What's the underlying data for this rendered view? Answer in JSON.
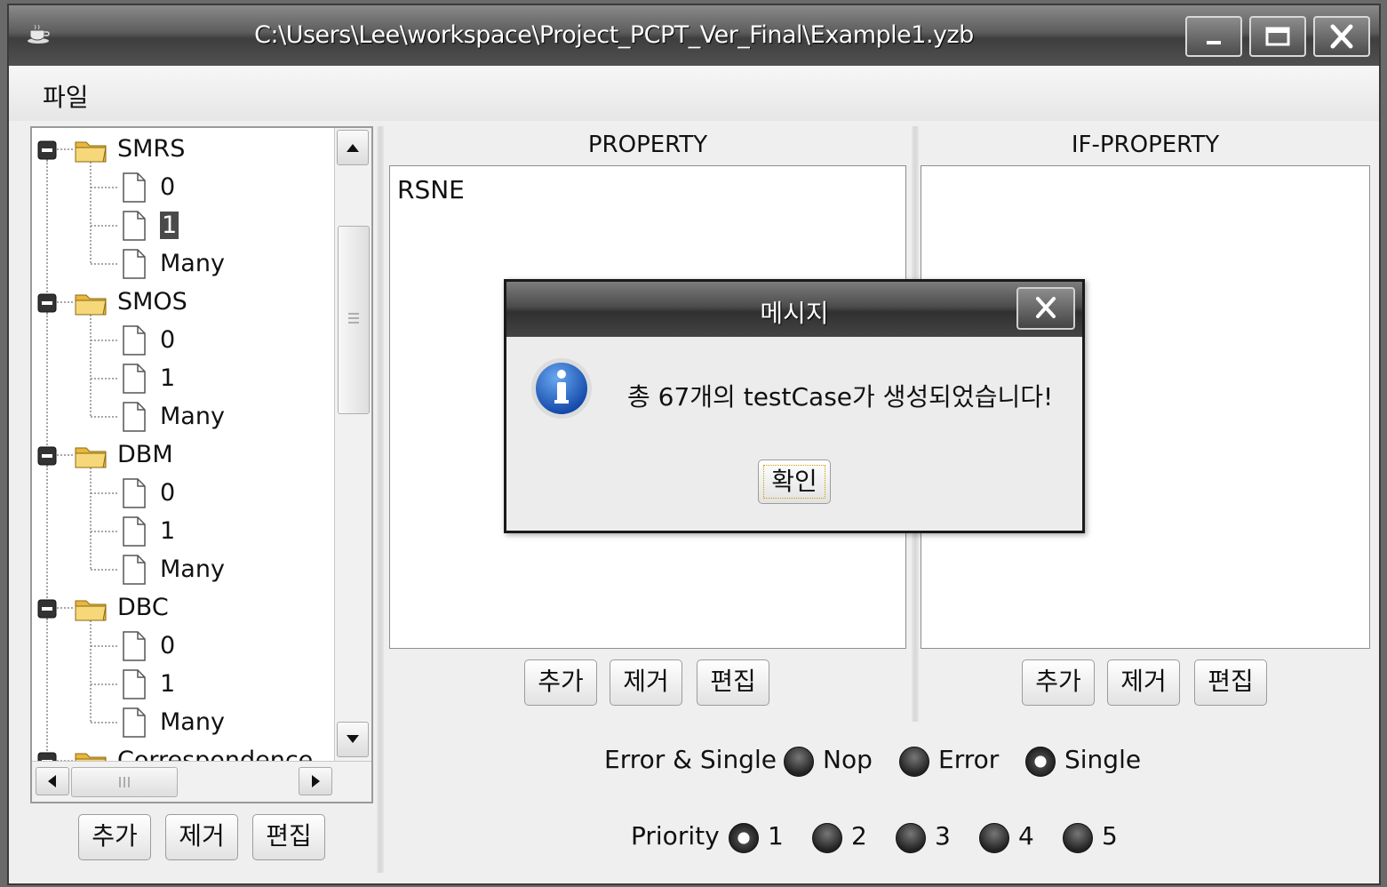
{
  "window": {
    "title": "C:\\Users\\Lee\\workspace\\Project_PCPT_Ver_Final\\Example1.yzb",
    "app_icon": "coffee-cup-icon",
    "controls": [
      "minimize-icon",
      "maximize-icon",
      "close-icon"
    ]
  },
  "menu": {
    "file": "파일"
  },
  "tree": {
    "items": [
      {
        "label": "SMRS",
        "type": "folder"
      },
      {
        "label": "0",
        "type": "file"
      },
      {
        "label": "1",
        "type": "file",
        "selected": true
      },
      {
        "label": "Many",
        "type": "file"
      },
      {
        "label": "SMOS",
        "type": "folder"
      },
      {
        "label": "0",
        "type": "file"
      },
      {
        "label": "1",
        "type": "file"
      },
      {
        "label": "Many",
        "type": "file"
      },
      {
        "label": "DBM",
        "type": "folder"
      },
      {
        "label": "0",
        "type": "file"
      },
      {
        "label": "1",
        "type": "file"
      },
      {
        "label": "Many",
        "type": "file"
      },
      {
        "label": "DBC",
        "type": "folder"
      },
      {
        "label": "0",
        "type": "file"
      },
      {
        "label": "1",
        "type": "file"
      },
      {
        "label": "Many",
        "type": "file"
      },
      {
        "label": "Correspondence",
        "type": "folder"
      }
    ],
    "buttons": {
      "add": "추가",
      "remove": "제거",
      "edit": "편집"
    }
  },
  "property": {
    "header": "PROPERTY",
    "items": [
      "RSNE"
    ],
    "buttons": {
      "add": "추가",
      "remove": "제거",
      "edit": "편집"
    }
  },
  "if_property": {
    "header": "IF-PROPERTY",
    "items": [],
    "buttons": {
      "add": "추가",
      "remove": "제거",
      "edit": "편집"
    }
  },
  "error_single": {
    "label": "Error & Single",
    "options": [
      "Nop",
      "Error",
      "Single"
    ],
    "selected": "Single"
  },
  "priority": {
    "label": "Priority",
    "options": [
      "1",
      "2",
      "3",
      "4",
      "5"
    ],
    "selected": "1"
  },
  "dialog": {
    "title": "메시지",
    "message": "총 67개의 testCase가 생성되었습니다!",
    "ok": "확인",
    "icon": "info-icon"
  },
  "colors": {
    "titlebar": "#4a4a4a",
    "info_blue": "#1f63c6",
    "folder_yellow": "#f2c94c",
    "selection": "#4a4a4a"
  }
}
